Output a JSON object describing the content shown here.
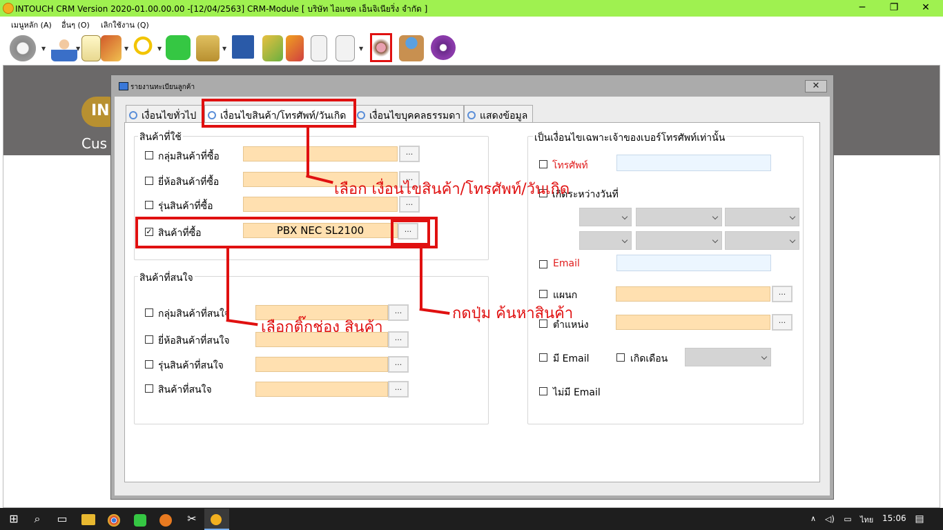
{
  "window": {
    "title": "INTOUCH CRM Version 2020-01.00.00.00 -[12/04/2563] CRM-Module  [ บริษัท ไอแซค เอ็นจิเนียริ่ง จำกัด ]",
    "minimize": "─",
    "restore": "❐",
    "close": "✕"
  },
  "menu": [
    "เมนูหลัก (A)",
    "อื่นๆ (O)",
    "เลิกใช้งาน (Q)"
  ],
  "toolbar_icons": [
    "gear-icon",
    "user-icon",
    "notepad-icon",
    "tools-icon",
    "search-icon",
    "chat-icon",
    "folder-add-icon",
    "chart-icon",
    "money-icon",
    "pin-icon",
    "document-icon",
    "report-icon",
    "cake-icon",
    "globe-box-icon",
    "podcast-icon"
  ],
  "background": {
    "logo": "IN",
    "caption": "Cus"
  },
  "dialog": {
    "title": "รายงานทะเบียนลูกค้า",
    "close": "✕",
    "tabs": [
      "เงื่อนไขทั่วไป",
      "เงื่อนไขสินค้า/โทรศัพท์/วันเกิด",
      "เงื่อนไขบุคคลธรรมดา",
      "แสดงข้อมูล"
    ],
    "product_used": {
      "title": "สินค้าที่ใช้",
      "rows": [
        {
          "label": "กลุ่มสินค้าที่ซื้อ",
          "checked": false,
          "value": ""
        },
        {
          "label": "ยี่ห้อสินค้าที่ซื้อ",
          "checked": false,
          "value": ""
        },
        {
          "label": "รุ่นสินค้าที่ซื้อ",
          "checked": false,
          "value": ""
        },
        {
          "label": "สินค้าที่ซื้อ",
          "checked": true,
          "value": "PBX NEC SL2100"
        }
      ],
      "browse": "..."
    },
    "product_interest": {
      "title": "สินค้าที่สนใจ",
      "rows": [
        {
          "label": "กลุ่มสินค้าที่สนใจ",
          "checked": false
        },
        {
          "label": "ยี่ห้อสินค้าที่สนใจ",
          "checked": false
        },
        {
          "label": "รุ่นสินค้าที่สนใจ",
          "checked": false
        },
        {
          "label": "สินค้าที่สนใจ",
          "checked": false
        }
      ]
    },
    "phone_owner": {
      "title": "เป็นเงื่อนไขเฉพาะเจ้าของเบอร์โทรศัพท์เท่านั้น",
      "phone": "โทรศัพท์",
      "birth_between": "เกิดระหว่างวันที่",
      "email": "Email",
      "department": "แผนก",
      "position": "ตำแหน่ง",
      "has_email": "มี Email",
      "birth_month": "เกิดเดือน",
      "no_email": "ไม่มี Email"
    }
  },
  "annotations": {
    "tab_hint": "เลือก เงื่อนไขสินค้า/โทรศัพท์/วันเกิด",
    "check_hint": "เลือกติ๊กช่อง สินค้า",
    "button_hint": "กดปุ่ม ค้นหาสินค้า"
  },
  "taskbar": {
    "lang": "ไทย",
    "time": "15:06"
  },
  "colors": {
    "titlebar": "#9ff150",
    "highlight": "#e01010",
    "field": "#ffe0b0"
  }
}
